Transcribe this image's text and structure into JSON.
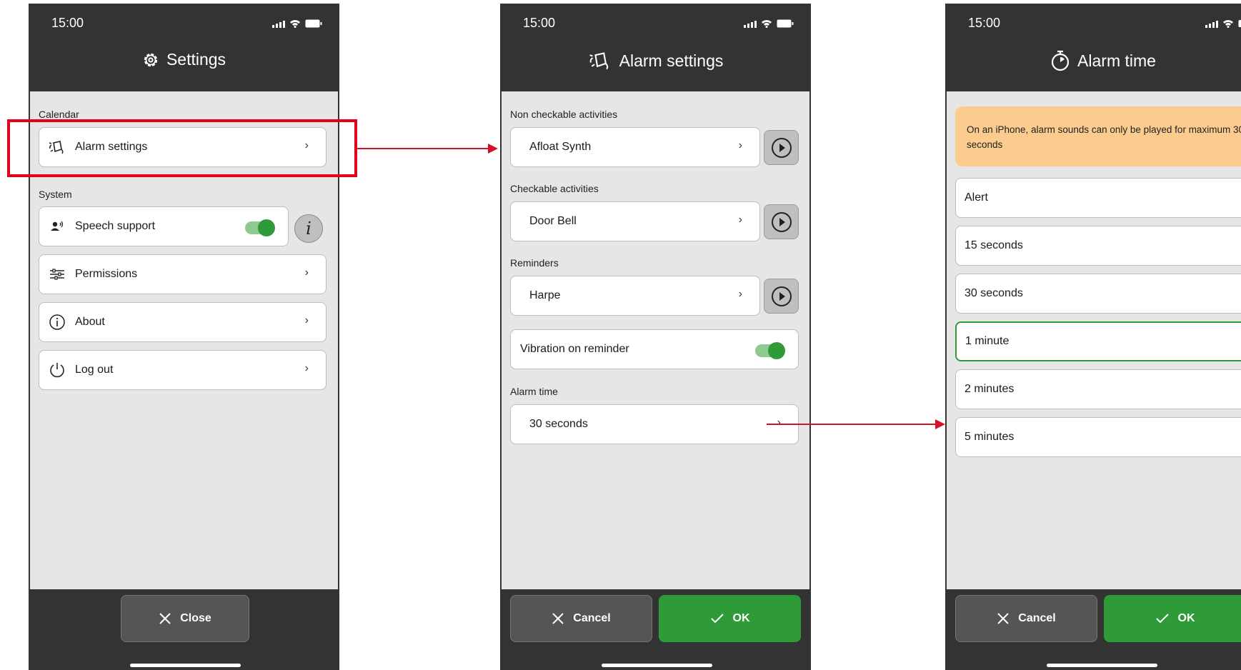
{
  "colors": {
    "accent_green": "#2f9a38",
    "header": "#333333",
    "notice": "#fbcc8e",
    "highlight": "#e3001b"
  },
  "status_time": "15:00",
  "screen1": {
    "title": "Settings",
    "title_icon": "gear-icon",
    "section_calendar": "Calendar",
    "alarm_settings": "Alarm settings",
    "section_system": "System",
    "speech_support": "Speech support",
    "speech_support_on": true,
    "permissions": "Permissions",
    "about": "About",
    "log_out": "Log out",
    "close": "Close"
  },
  "screen2": {
    "title": "Alarm settings",
    "title_icon": "alarm-bell-icon",
    "section_non_checkable": "Non checkable activities",
    "non_checkable_value": "Afloat Synth",
    "section_checkable": "Checkable activities",
    "checkable_value": "Door Bell",
    "section_reminders": "Reminders",
    "reminders_value": "Harpe",
    "vibration_on_reminder": "Vibration on reminder",
    "vibration_on": true,
    "section_alarm_time": "Alarm time",
    "alarm_time_value": "30 seconds",
    "cancel": "Cancel",
    "ok": "OK"
  },
  "screen3": {
    "title": "Alarm time",
    "title_icon": "stopwatch-icon",
    "notice": "On an iPhone, alarm sounds can only be played for maximum 30 seconds",
    "options": [
      "Alert",
      "15 seconds",
      "30 seconds",
      "1 minute",
      "2 minutes",
      "5 minutes"
    ],
    "selected": "1 minute",
    "cancel": "Cancel",
    "ok": "OK"
  }
}
